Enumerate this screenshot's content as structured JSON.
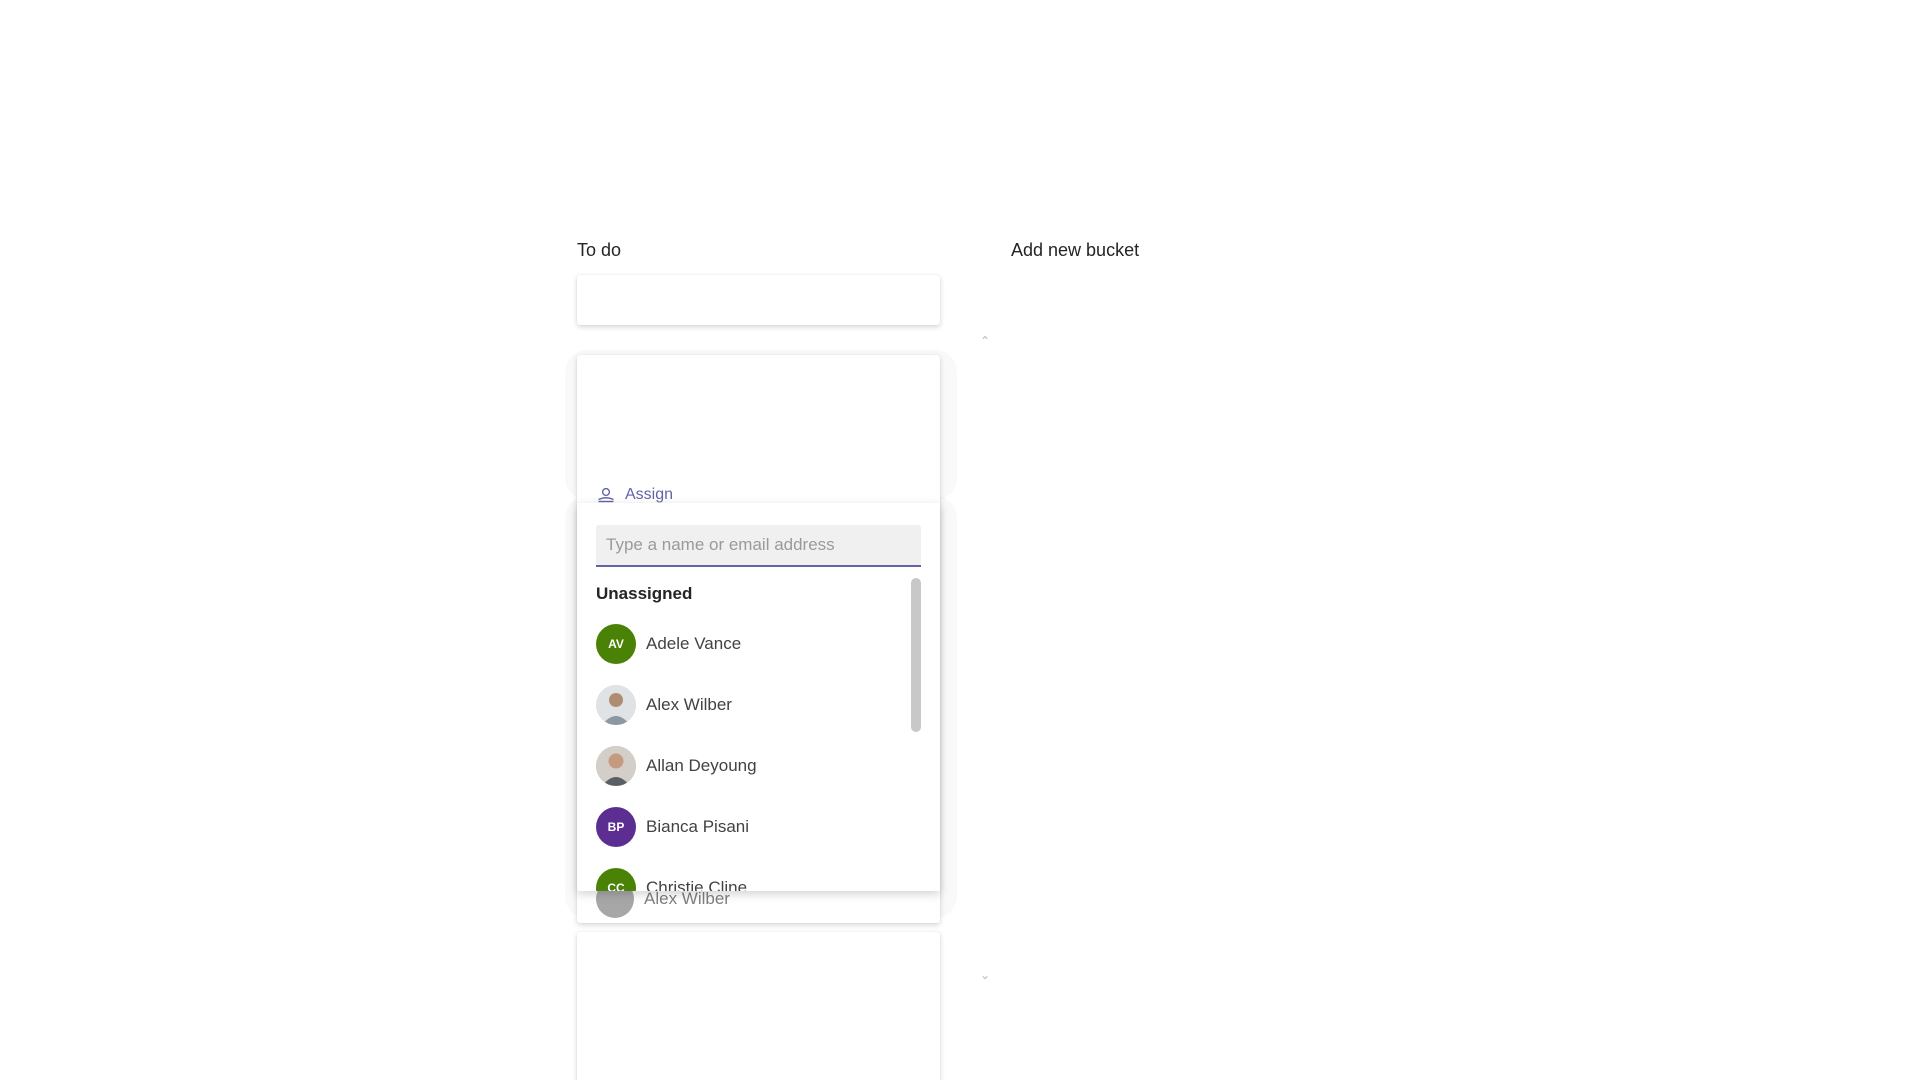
{
  "board": {
    "bucket_title": "To do",
    "add_bucket_label": "Add new bucket"
  },
  "assign": {
    "label": "Assign"
  },
  "picker": {
    "placeholder": "Type a name or email address",
    "group_label": "Unassigned",
    "people": [
      {
        "name": "Adele Vance",
        "initials": "AV",
        "avatar_color": "#498205",
        "has_photo": false
      },
      {
        "name": "Alex Wilber",
        "initials": "",
        "avatar_color": "#9aa3ab",
        "has_photo": true
      },
      {
        "name": "Allan Deyoung",
        "initials": "",
        "avatar_color": "#b7b0a6",
        "has_photo": true
      },
      {
        "name": "Bianca Pisani",
        "initials": "BP",
        "avatar_color": "#5c2e91",
        "has_photo": false
      },
      {
        "name": "Christie Cline",
        "initials": "CC",
        "avatar_color": "#498205",
        "has_photo": false
      }
    ]
  },
  "behind_card": {
    "assignee_name": "Alex Wilber"
  },
  "colors": {
    "accent": "#6264a7",
    "text": "#242424"
  }
}
